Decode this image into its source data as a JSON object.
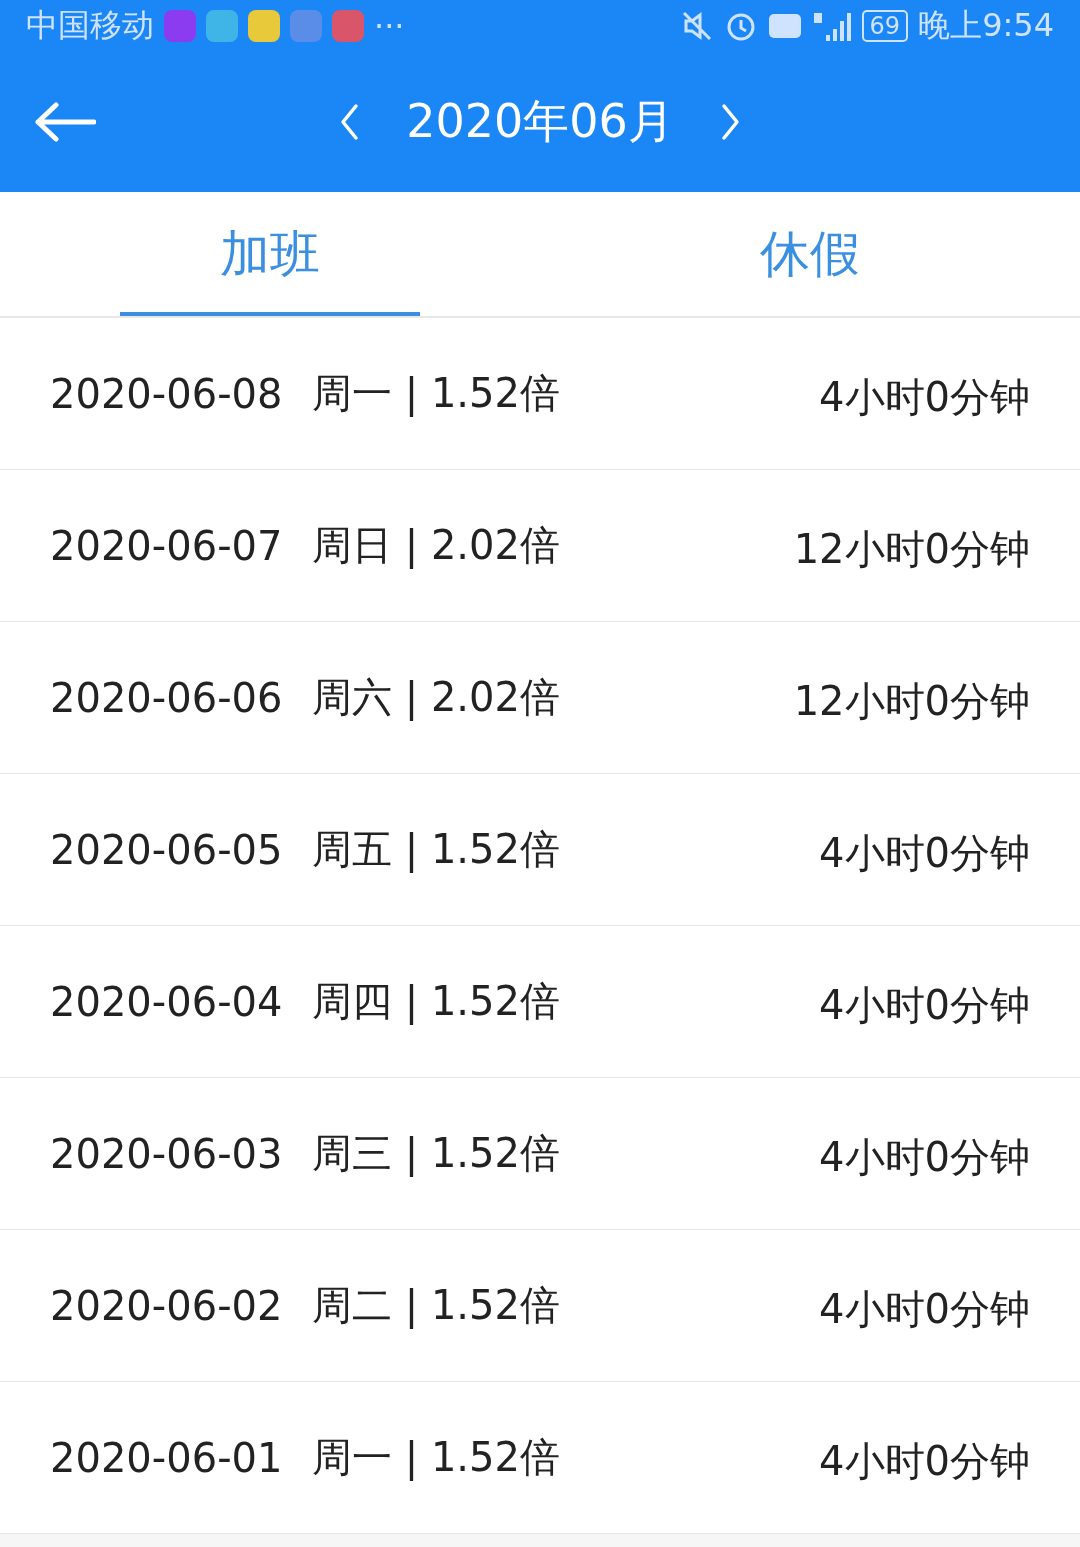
{
  "status_bar": {
    "carrier": "中国移动",
    "more": "···",
    "battery": "69",
    "time": "晚上9:54"
  },
  "header": {
    "title": "2020年06月"
  },
  "tabs": [
    {
      "label": "加班",
      "selected": true
    },
    {
      "label": "休假",
      "selected": false
    }
  ],
  "rows": [
    {
      "date": "2020-06-08",
      "info": "周一 | 1.52倍",
      "duration": "4小时0分钟"
    },
    {
      "date": "2020-06-07",
      "info": "周日 | 2.02倍",
      "duration": "12小时0分钟"
    },
    {
      "date": "2020-06-06",
      "info": "周六 | 2.02倍",
      "duration": "12小时0分钟"
    },
    {
      "date": "2020-06-05",
      "info": "周五 | 1.52倍",
      "duration": "4小时0分钟"
    },
    {
      "date": "2020-06-04",
      "info": "周四 | 1.52倍",
      "duration": "4小时0分钟"
    },
    {
      "date": "2020-06-03",
      "info": "周三 | 1.52倍",
      "duration": "4小时0分钟"
    },
    {
      "date": "2020-06-02",
      "info": "周二 | 1.52倍",
      "duration": "4小时0分钟"
    },
    {
      "date": "2020-06-01",
      "info": "周一 | 1.52倍",
      "duration": "4小时0分钟"
    }
  ]
}
